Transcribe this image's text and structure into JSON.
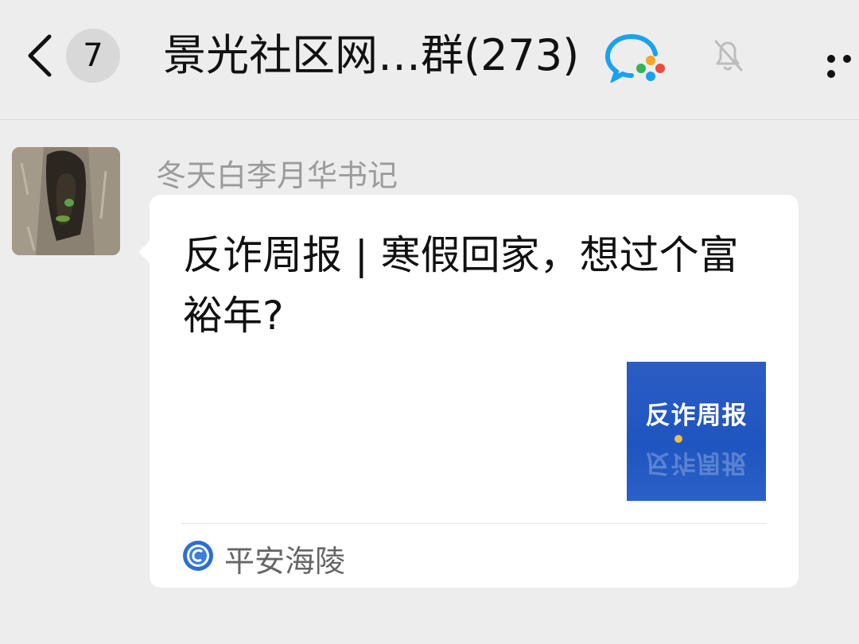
{
  "header": {
    "unread_count": "7",
    "chat_title": "景光社区网…群(273)",
    "icons": [
      "back-icon",
      "wecom-icon",
      "mute-bell-icon",
      "more-icon"
    ]
  },
  "message": {
    "sender_name": "冬天白李月华书记",
    "article_title": "反诈周报 | 寒假回家，想过个富裕年?",
    "thumbnail_text": "反诈周报",
    "source_name": "平安海陵"
  },
  "colors": {
    "background": "#ededed",
    "bubble": "#ffffff",
    "thumbnail_blue": "#1f55c0",
    "name_gray": "#9b9b9b"
  }
}
